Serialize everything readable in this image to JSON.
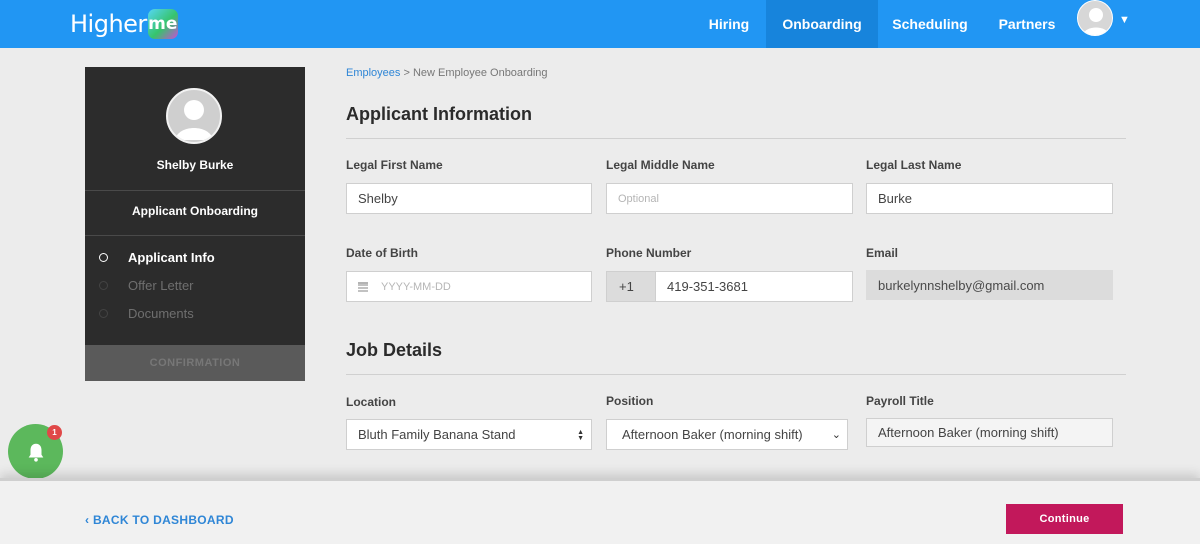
{
  "header": {
    "logo_text": "Higher",
    "logo_mark": "me",
    "nav": [
      "Hiring",
      "Onboarding",
      "Scheduling",
      "Partners"
    ],
    "active_nav": "Onboarding",
    "brand_color": "#2196f3"
  },
  "sidebar": {
    "name": "Shelby Burke",
    "section": "Applicant Onboarding",
    "steps": [
      {
        "label": "Applicant Info",
        "state": "active"
      },
      {
        "label": "Offer Letter",
        "state": "inactive"
      },
      {
        "label": "Documents",
        "state": "inactive"
      }
    ],
    "confirm_label": "CONFIRMATION"
  },
  "breadcrumb": {
    "link": "Employees",
    "separator": ">",
    "current": "New Employee Onboarding"
  },
  "applicant": {
    "title": "Applicant Information",
    "first_name_label": "Legal First Name",
    "first_name_value": "Shelby",
    "middle_name_label": "Legal Middle Name",
    "middle_name_placeholder": "Optional",
    "last_name_label": "Legal Last Name",
    "last_name_value": "Burke",
    "dob_label": "Date of Birth",
    "dob_placeholder": "YYYY-MM-DD",
    "phone_label": "Phone Number",
    "phone_prefix": "+1",
    "phone_value": "419-351-3681",
    "email_label": "Email",
    "email_value": "burkelynnshelby@gmail.com"
  },
  "job": {
    "title": "Job Details",
    "location_label": "Location",
    "location_value": "Bluth Family Banana Stand",
    "position_label": "Position",
    "position_value": "Afternoon Baker (morning shift)",
    "payroll_label": "Payroll Title",
    "payroll_value": "Afternoon Baker (morning shift)"
  },
  "notifications": {
    "count": "1",
    "icon": "bell-icon"
  },
  "footer": {
    "back_label": "BACK TO DASHBOARD",
    "back_icon": "chevron-left-icon",
    "continue_label": "Continue",
    "continue_color": "#c2185b"
  }
}
